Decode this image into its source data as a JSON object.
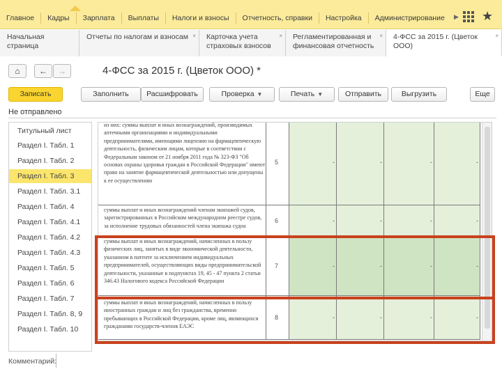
{
  "menu": {
    "items": [
      "Главное",
      "Кадры",
      "Зарплата",
      "Выплаты",
      "Налоги и взносы",
      "Отчетность, справки",
      "Настройка",
      "Администрирование"
    ]
  },
  "tabs": [
    {
      "label": "Начальная страница",
      "closable": false
    },
    {
      "label": "Отчеты по налогам и взносам",
      "closable": true
    },
    {
      "label": "Карточка учета страховых взносов",
      "closable": true
    },
    {
      "label": "Регламентированная и финансовая отчетность",
      "closable": true
    },
    {
      "label": "4-ФСС за 2015 г. (Цветок ООО)",
      "closable": true
    }
  ],
  "nav": {
    "home": "⌂",
    "back": "←",
    "forward": "→"
  },
  "document": {
    "title": "4-ФСС за 2015 г. (Цветок ООО) *"
  },
  "toolbar": {
    "save": "Записать",
    "fill": "Заполнить",
    "decode": "Расшифровать",
    "check": "Проверка",
    "print": "Печать",
    "send": "Отправить",
    "upload": "Выгрузить",
    "more": "Еще"
  },
  "status": "Не отправлено",
  "sidebar": {
    "items": [
      "Титульный лист",
      "Раздел I. Табл. 1",
      "Раздел I. Табл. 2",
      "Раздел I. Табл. 3",
      "Раздел I. Табл. 3.1",
      "Раздел I. Табл. 4",
      "Раздел I. Табл. 4.1",
      "Раздел I. Табл. 4.2",
      "Раздел I. Табл. 4.3",
      "Раздел I. Табл. 5",
      "Раздел I. Табл. 6",
      "Раздел I. Табл. 7",
      "Раздел I. Табл. 8, 9",
      "Раздел I. Табл. 10"
    ],
    "active_index": 3
  },
  "table": {
    "rows": [
      {
        "code": "5",
        "text": "из них:\nсуммы выплат и иных вознаграждений, производимых аптечными организациями и индивидуальными предпринимателями, имеющими лицензию на фармацевтическую деятельность, физическим лицам, которые в соответствии с Федеральным законом от 21 ноября 2011 года № 323-ФЗ \"Об основах охраны здоровья граждан в Российской Федерации\" имеют право на занятие фармацевтической деятельностью или допущены к ее осуществлению",
        "values": [
          "-",
          "-",
          "-",
          "-"
        ]
      },
      {
        "code": "6",
        "text": "суммы выплат и иных вознаграждений членам экипажей судов, зарегистрированных в Российском международном реестре судов, за исполнение трудовых обязанностей члена экипажа судна",
        "values": [
          "-",
          "-",
          "-",
          "-"
        ]
      },
      {
        "code": "7",
        "text": "суммы выплат и иных вознаграждений, начисленных в пользу физических лиц, занятых в виде экономической деятельности, указанном в патенте за исключением индивидуальных предпринимателей, осуществляющих виды предпринимательской деятельности, указанные в подпунктах 19, 45 - 47 пункта 2 статьи 346.43 Налогового кодекса Российской Федерации",
        "values": [
          "-",
          "-",
          "-",
          "-"
        ]
      },
      {
        "code": "8",
        "text": "суммы выплат и иных вознаграждений, начисленных в пользу иностранных граждан и лиц без гражданства, временно пребывающих в Российской Федерации, кроме лиц, являющихся гражданами государств-членов ЕАЭС",
        "values": [
          "-",
          "-",
          "-",
          "-"
        ]
      }
    ]
  },
  "comment": {
    "label": "Комментарий:"
  },
  "colors": {
    "menu_bg": "#fbeb9b",
    "save_button": "#fbd52f",
    "highlight": "#c8421e",
    "active_sidebar": "#fbe56c",
    "cell_green": "#e5f0da"
  }
}
